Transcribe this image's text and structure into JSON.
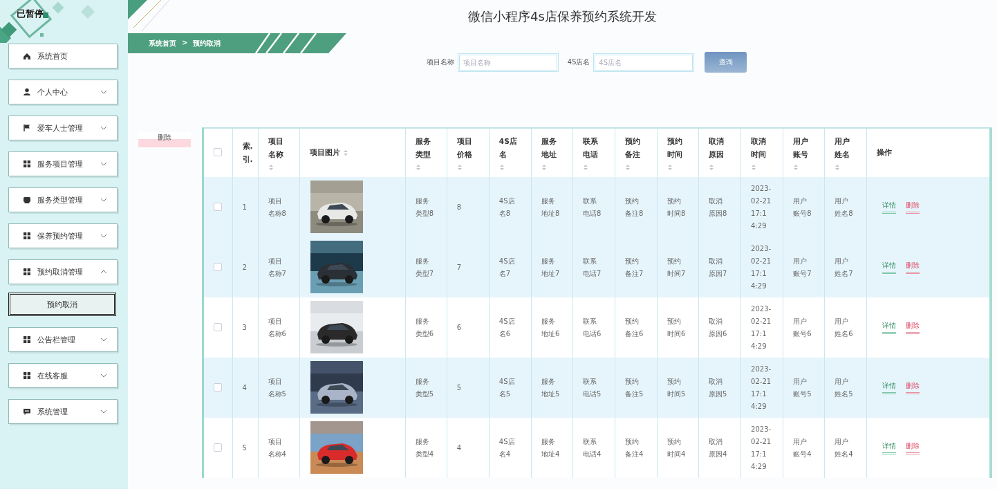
{
  "paused_label": "已暂停",
  "sidebar": {
    "items": [
      {
        "kind": "link",
        "label": "系统首页"
      },
      {
        "kind": "group",
        "label": "个人中心",
        "expanded": false
      },
      {
        "kind": "group",
        "label": "爱车人士管理",
        "expanded": false
      },
      {
        "kind": "group",
        "label": "服务项目管理",
        "expanded": false
      },
      {
        "kind": "group",
        "label": "服务类型管理",
        "expanded": false
      },
      {
        "kind": "group",
        "label": "保养预约管理",
        "expanded": false
      },
      {
        "kind": "group",
        "label": "预约取消管理",
        "expanded": true,
        "children": [
          {
            "label": "预约取消",
            "selected": true
          }
        ]
      },
      {
        "kind": "group",
        "label": "公告栏管理",
        "expanded": false
      },
      {
        "kind": "group",
        "label": "在线客服",
        "expanded": false
      },
      {
        "kind": "group",
        "label": "系统管理",
        "expanded": false
      }
    ]
  },
  "title": "微信小程序4s店保养预约系统开发",
  "breadcrumb": {
    "items": [
      "系统首页",
      "预约取消"
    ],
    "separator": ">"
  },
  "search": {
    "fields": [
      {
        "label": "项目名称",
        "placeholder": "项目名称"
      },
      {
        "label": "4S店名",
        "placeholder": "4S店名"
      }
    ],
    "button": "查询"
  },
  "delete_button": "删除",
  "table": {
    "columns": [
      {
        "kind": "checkbox",
        "checked": false
      },
      {
        "kind": "text",
        "label": "索.引.",
        "sortable": false
      },
      {
        "kind": "text",
        "label": "项目名称",
        "sortable": true
      },
      {
        "kind": "text",
        "label": "项目图片",
        "sortable": true
      },
      {
        "kind": "text",
        "label": "服务类型",
        "sortable": true
      },
      {
        "kind": "text",
        "label": "项目价格",
        "sortable": true
      },
      {
        "kind": "text",
        "label": "4S店名",
        "sortable": true
      },
      {
        "kind": "text",
        "label": "服务地址",
        "sortable": true
      },
      {
        "kind": "text",
        "label": "联系电话",
        "sortable": true
      },
      {
        "kind": "text",
        "label": "预约备注",
        "sortable": true
      },
      {
        "kind": "text",
        "label": "预约时间",
        "sortable": true
      },
      {
        "kind": "text",
        "label": "取消原因",
        "sortable": true
      },
      {
        "kind": "text",
        "label": "取消时间",
        "sortable": true
      },
      {
        "kind": "text",
        "label": "用户账号",
        "sortable": true
      },
      {
        "kind": "text",
        "label": "用户姓名",
        "sortable": true
      },
      {
        "kind": "text",
        "label": "操作",
        "sortable": false
      }
    ],
    "rows": [
      {
        "checked": false,
        "hovered": true,
        "cells": [
          "",
          "1",
          "项目名称8",
          "",
          "服务类型8",
          "8",
          "4S店名8",
          "服务地址8",
          "联系电话8",
          "预约备注8",
          "预约时间8",
          "取消原因8",
          "2023-02-21 17:14:29",
          "用户账号8",
          "用户姓名8"
        ],
        "actions": [
          "详情",
          "删除"
        ]
      },
      {
        "checked": false,
        "hovered": true,
        "cells": [
          "",
          "2",
          "项目名称7",
          "",
          "服务类型7",
          "7",
          "4S店名7",
          "服务地址7",
          "联系电话7",
          "预约备注7",
          "预约时间7",
          "取消原因7",
          "2023-02-21 17:14:29",
          "用户账号7",
          "用户姓名7"
        ],
        "actions": [
          "详情",
          "删除"
        ]
      },
      {
        "checked": false,
        "hovered": false,
        "cells": [
          "",
          "3",
          "项目名称6",
          "",
          "服务类型6",
          "6",
          "4S店名6",
          "服务地址6",
          "联系电话6",
          "预约备注6",
          "预约时间6",
          "取消原因6",
          "2023-02-21 17:14:29",
          "用户账号6",
          "用户姓名6"
        ],
        "actions": [
          "详情",
          "删除"
        ]
      },
      {
        "checked": false,
        "hovered": true,
        "cells": [
          "",
          "4",
          "项目名称5",
          "",
          "服务类型5",
          "5",
          "4S店名5",
          "服务地址5",
          "联系电话5",
          "预约备注5",
          "预约时间5",
          "取消原因5",
          "2023-02-21 17:14:29",
          "用户账号5",
          "用户姓名5"
        ],
        "actions": [
          "详情",
          "删除"
        ]
      },
      {
        "checked": false,
        "hovered": false,
        "cells": [
          "",
          "5",
          "项目名称4",
          "",
          "服务类型4",
          "4",
          "4S店名4",
          "服务地址4",
          "联系电话4",
          "预约备注4",
          "预约时间4",
          "取消原因4",
          "2023-02-21 17:14:29",
          "用户账号4",
          "用户姓名4"
        ],
        "actions": [
          "详情",
          "删除"
        ]
      }
    ]
  }
}
